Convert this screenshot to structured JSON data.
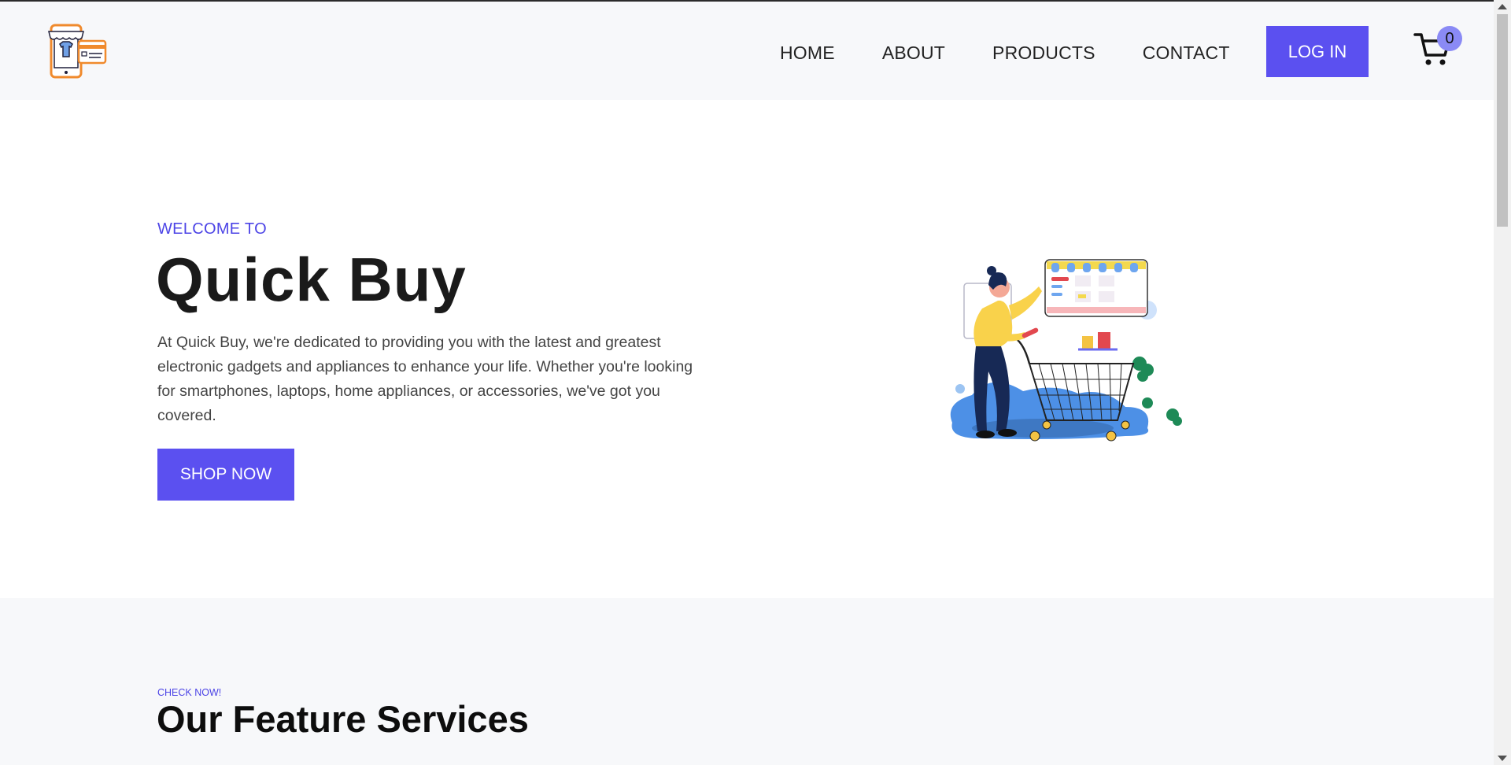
{
  "header": {
    "nav": [
      {
        "label": "HOME"
      },
      {
        "label": "ABOUT"
      },
      {
        "label": "PRODUCTS"
      },
      {
        "label": "CONTACT"
      }
    ],
    "login_label": "LOG IN",
    "cart_count": "0"
  },
  "hero": {
    "eyebrow": "WELCOME TO",
    "title": "Quick Buy",
    "description": "At Quick Buy, we're dedicated to providing you with the latest and greatest electronic gadgets and appliances to enhance your life. Whether you're looking for smartphones, laptops, home appliances, or accessories, we've got you covered.",
    "cta_label": "SHOP NOW"
  },
  "features": {
    "eyebrow": "CHECK NOW!",
    "title": "Our Feature Services"
  },
  "colors": {
    "accent": "#5b50f0",
    "accent_text": "#4c44e6",
    "badge": "#8a8af5",
    "header_bg": "#f7f8fa"
  },
  "icons": [
    "store-logo-icon",
    "cart-icon",
    "shopping-illustration"
  ]
}
